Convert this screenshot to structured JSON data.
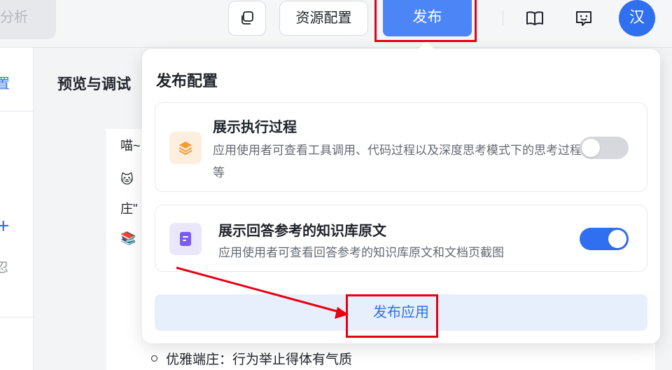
{
  "topbar": {
    "analysis_label": "分析",
    "resource_label": "资源配置",
    "publish_label": "发布",
    "avatar_text": "汉"
  },
  "sidebar": {
    "config_label": "置",
    "plus_label": "+",
    "meta_label": "忍"
  },
  "main": {
    "preview_title": "预览与调试",
    "chat_lines": [
      "喵~",
      "🐱",
      "庄\"",
      "📚"
    ],
    "bullet_text": "优雅端庄：行为举止得体有气质"
  },
  "popover": {
    "title": "发布配置",
    "options": [
      {
        "title": "展示执行过程",
        "description": "应用使用者可查看工具调用、代码过程以及深度思考模式下的思考过程等",
        "enabled": false
      },
      {
        "title": "展示回答参考的知识库原文",
        "description": "应用使用者可查看回答参考的知识库原文和文档页截图",
        "enabled": true
      }
    ],
    "publish_app_label": "发布应用"
  },
  "colors": {
    "accent": "#2f6ff0",
    "publish_button": "#4c86f6",
    "highlight": "#e60012"
  }
}
